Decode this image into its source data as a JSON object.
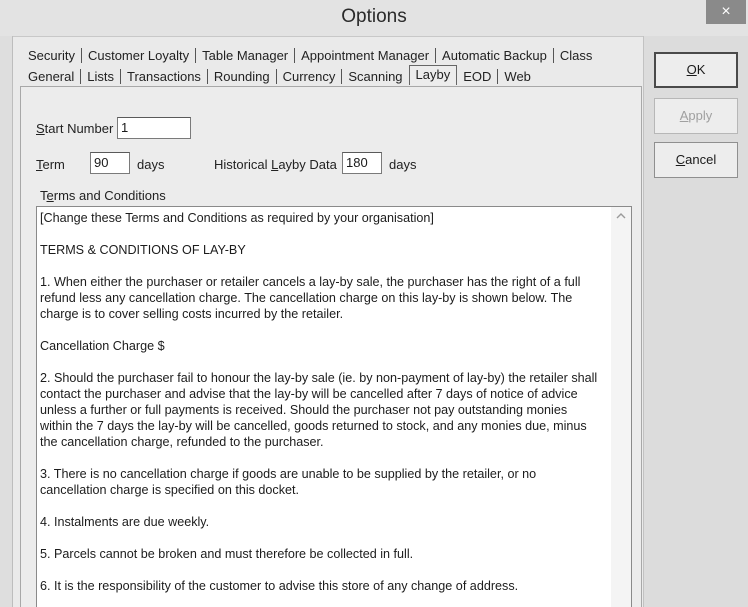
{
  "window": {
    "title": "Options",
    "close_glyph": "×"
  },
  "tabs": {
    "row1": [
      "Security",
      "Customer Loyalty",
      "Table Manager",
      "Appointment Manager",
      "Automatic Backup",
      "Class"
    ],
    "row2": [
      "General",
      "Lists",
      "Transactions",
      "Rounding",
      "Currency",
      "Scanning",
      "Layby",
      "EOD",
      "Web"
    ],
    "active": "Layby"
  },
  "form": {
    "start_number": {
      "prefix": "S",
      "rest": "tart Number",
      "value": "1"
    },
    "term": {
      "prefix": "T",
      "rest": "erm",
      "value": "90",
      "unit": "days"
    },
    "historical": {
      "before": "Historical ",
      "accel": "L",
      "after": "ayby Data",
      "value": "180",
      "unit": "days"
    },
    "terms_label": {
      "before": "T",
      "accel": "e",
      "after": "rms and Conditions"
    }
  },
  "terms_text": [
    "[Change these Terms and Conditions as required by your organisation]",
    "TERMS & CONDITIONS OF LAY-BY",
    "1. When either the purchaser or retailer cancels a lay-by sale, the purchaser has the right of a full refund less any cancellation charge.  The cancellation charge on this lay-by is shown below. The charge is to cover selling costs incurred by the retailer.",
    "Cancellation Charge $",
    "2. Should the purchaser fail to honour the lay-by sale (ie. by non-payment of lay-by) the retailer shall contact the purchaser and advise that the lay-by will be cancelled after 7 days of notice of advice unless a further or full payments is received.  Should the purchaser not pay outstanding monies within the 7 days the lay-by will be cancelled, goods returned to stock, and any monies due, minus the cancellation charge, refunded to the purchaser.",
    "3. There is no cancellation charge if goods are unable to be supplied by the retailer, or no cancellation charge is specified on this docket.",
    "4. Instalments are due weekly.",
    "5. Parcels cannot be broken and must therefore be collected in full.",
    "6. It is the responsibility of the customer to advise this store of any change of address."
  ],
  "buttons": {
    "ok": {
      "accel": "O",
      "rest": "K"
    },
    "apply": {
      "accel": "A",
      "rest": "pply",
      "enabled": false
    },
    "cancel": {
      "accel": "C",
      "rest": "ancel"
    }
  },
  "icons": {
    "close": "close-icon",
    "scroll_up": "chevron-up-icon"
  },
  "colors": {
    "title_bar": "#e3e3e3",
    "close_button": "#8a8a8a",
    "panel": "#ececec",
    "disabled_text": "#a0a0a0"
  }
}
